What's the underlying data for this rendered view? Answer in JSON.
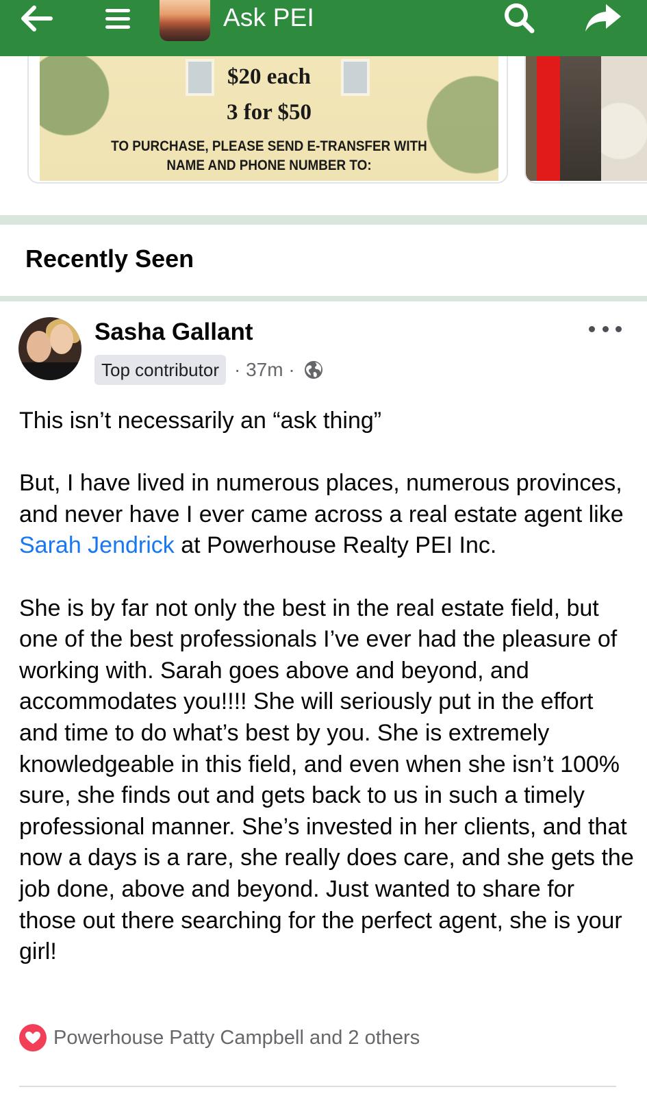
{
  "app_bar": {
    "title": "Ask PEI",
    "icons": [
      "back-arrow-icon",
      "hamburger-menu-icon",
      "search-icon",
      "share-arrow-icon"
    ],
    "background_color": "#2e8b3d"
  },
  "carousel": {
    "card1": {
      "price_line1": "$20 each",
      "price_line2": "3 for $50",
      "instruction_line1": "TO PURCHASE, PLEASE SEND E-TRANSFER WITH",
      "instruction_line2": "NAME AND PHONE NUMBER TO:"
    }
  },
  "section": {
    "title": "Recently Seen"
  },
  "post": {
    "author": "Sasha Gallant",
    "badge": "Top contributor",
    "time": "· 37m ·",
    "paragraph1": "This isn’t necessarily an “ask thing”",
    "paragraph2_before": "But, I have lived in numerous places, numerous provinces, and never have I ever came across a real estate agent like",
    "mention": "Sarah Jendrick",
    "paragraph2_after": "at Powerhouse Realty PEI Inc.",
    "paragraph3": "She is by far not only the best in the real estate field, but one of the best professionals I’ve ever had the pleasure of working with. Sarah goes above and beyond, and accommodates you!!!! She will seriously put in the effort and time to do what’s best by you. She is extremely knowledgeable in this field, and even when she isn’t 100% sure, she finds out and gets back to us in such a timely professional manner. She’s invested in her clients, and that now a days is a rare, she really does care, and she gets the job done, above and beyond. Just wanted to share for those out there searching for the perfect agent, she is your girl!",
    "reactions": "Powerhouse Patty Campbell and 2 others",
    "link_color": "#1877f2",
    "reaction_color": "#f33e58"
  }
}
